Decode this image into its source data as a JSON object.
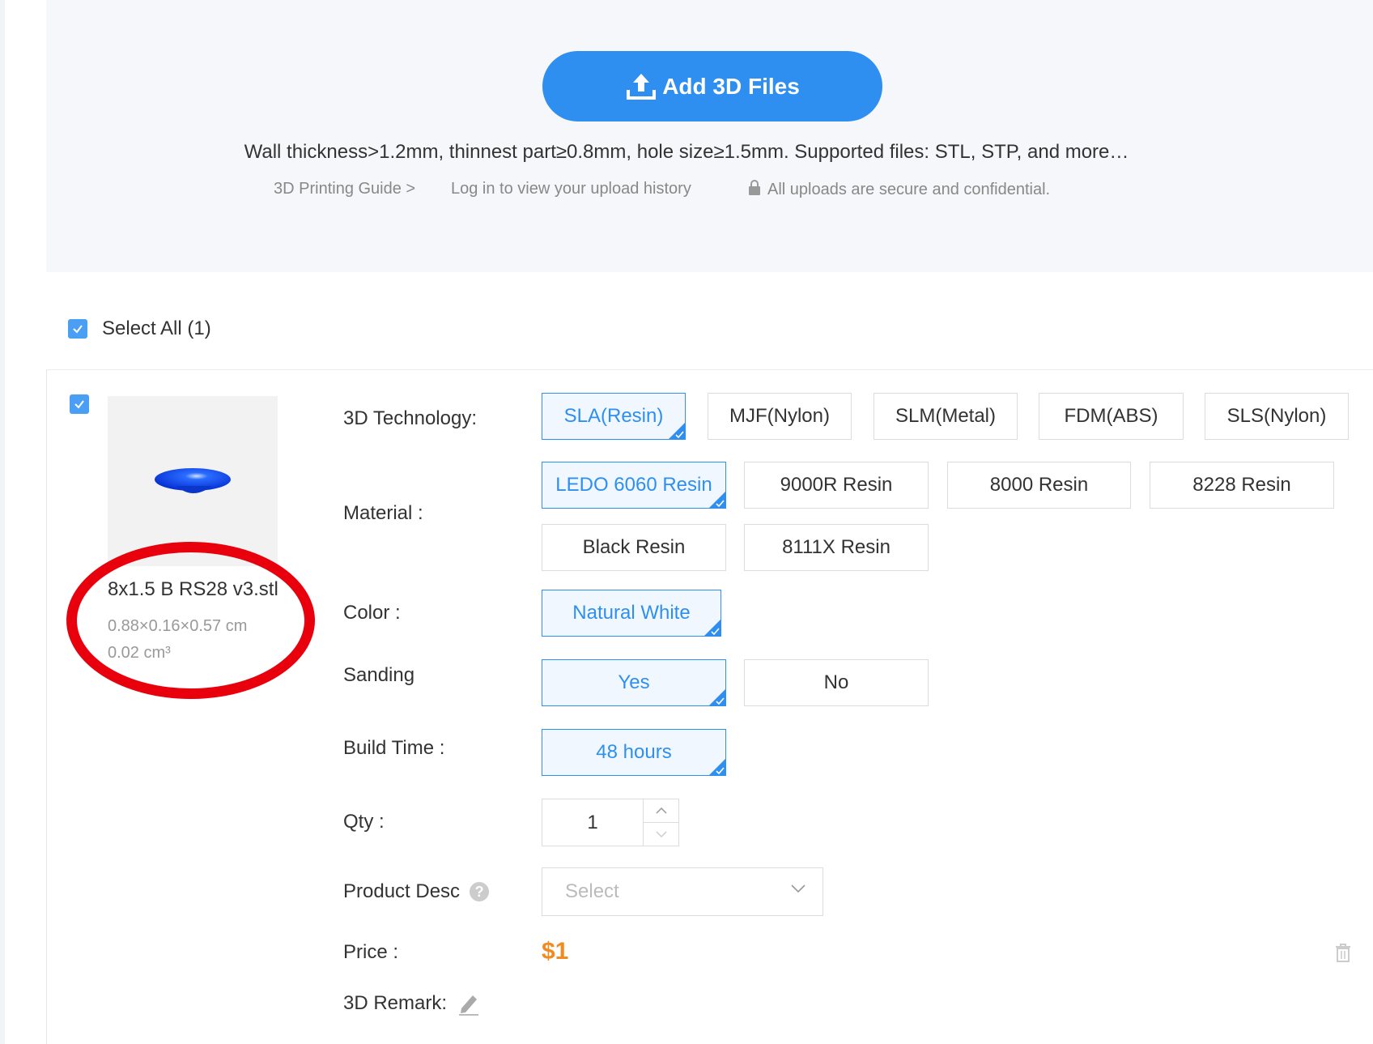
{
  "upload": {
    "add_button_label": "Add 3D Files",
    "hint": "Wall thickness>1.2mm, thinnest part≥0.8mm, hole size≥1.5mm. Supported files: STL, STP, and more…",
    "guide_link": "3D Printing Guide >",
    "history_link": "Log in to view your upload history",
    "secure_note": "All uploads are secure and confidential."
  },
  "select_all": {
    "label": "Select All (1)",
    "checked": true
  },
  "item": {
    "checked": true,
    "file_name": "8x1.5 B RS28 v3.stl",
    "dimensions": "0.88×0.16×0.57 cm",
    "volume": "0.02 cm³",
    "technology": {
      "label": "3D Technology:",
      "options": [
        "SLA(Resin)",
        "MJF(Nylon)",
        "SLM(Metal)",
        "FDM(ABS)",
        "SLS(Nylon)"
      ],
      "selected": "SLA(Resin)"
    },
    "material": {
      "label": "Material :",
      "options": [
        "LEDO 6060 Resin",
        "9000R Resin",
        "8000 Resin",
        "8228 Resin",
        "Black Resin",
        "8111X Resin"
      ],
      "selected": "LEDO 6060 Resin"
    },
    "color": {
      "label": "Color :",
      "options": [
        "Natural White"
      ],
      "selected": "Natural White"
    },
    "sanding": {
      "label": "Sanding",
      "options": [
        "Yes",
        "No"
      ],
      "selected": "Yes"
    },
    "build_time": {
      "label": "Build Time :",
      "options": [
        "48 hours"
      ],
      "selected": "48 hours"
    },
    "qty": {
      "label": "Qty :",
      "value": "1"
    },
    "product_desc": {
      "label": "Product Desc",
      "placeholder": "Select"
    },
    "price": {
      "label": "Price :",
      "value": "$1"
    },
    "remark": {
      "label": "3D Remark:"
    }
  },
  "colors": {
    "accent": "#2f8ff0",
    "price": "#f28a22",
    "annotation": "#e8000c"
  },
  "icons": [
    "upload-icon",
    "lock-icon",
    "check-icon",
    "help-icon",
    "edit-icon",
    "trash-icon",
    "chevron-down-icon",
    "chevron-up-icon"
  ]
}
